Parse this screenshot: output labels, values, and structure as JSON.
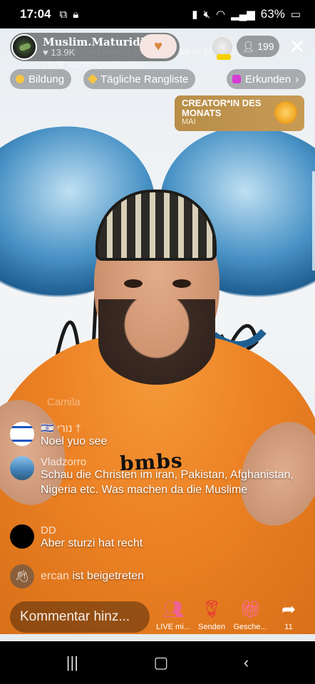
{
  "status_bar": {
    "time": "17:04",
    "battery": "63%"
  },
  "host": {
    "name": "Muslim.Maturidi",
    "likes": "13.9K"
  },
  "viewer_count": "199",
  "ghost_text": "Du 4 fre dest von di eser Mu erke in Moscan - for this LIVE stummgeschaltet",
  "chips": [
    {
      "label": "Bildung",
      "dot_color": "#f5c542"
    },
    {
      "label": "Tägliche Rangliste",
      "dot_color": "#f5c542"
    },
    {
      "label": "Erkunden",
      "dot_color": "#d63bd6"
    }
  ],
  "creator_card": {
    "title": "CREATOR*IN DES MONATS",
    "subtitle": "MAI"
  },
  "shirt_logo": "bmbs",
  "comments": [
    {
      "user": "Camila",
      "text": "",
      "avatar_color": "#888888",
      "faded": true
    },
    {
      "user": "🇮🇱 נורי †",
      "text": "Noel yuo see",
      "avatar_color": "#ffffff"
    },
    {
      "user": "Vladzorro",
      "text": "Schau die Christen im iran, Pakistan, Afghanistan, Nigeria etc. Was machen da die Muslime",
      "avatar_color": "#6fa7d8"
    },
    {
      "user": "DD",
      "text": "Aber sturzi hat recht",
      "avatar_color": "#000000"
    },
    {
      "user": "ercan",
      "text": "ist beigetreten",
      "avatar_color": "#444444"
    }
  ],
  "comment_input": {
    "placeholder": "Kommentar hinz..."
  },
  "actions": [
    {
      "label": "LIVE mi...",
      "icon": "people-icon",
      "color": "#f06292"
    },
    {
      "label": "Senden",
      "icon": "rose-icon",
      "color": "#e53935"
    },
    {
      "label": "Gesche...",
      "icon": "gift-icon",
      "color": "#ff6b9a"
    },
    {
      "label": "11",
      "icon": "share-icon",
      "color": "#ffffff"
    }
  ]
}
